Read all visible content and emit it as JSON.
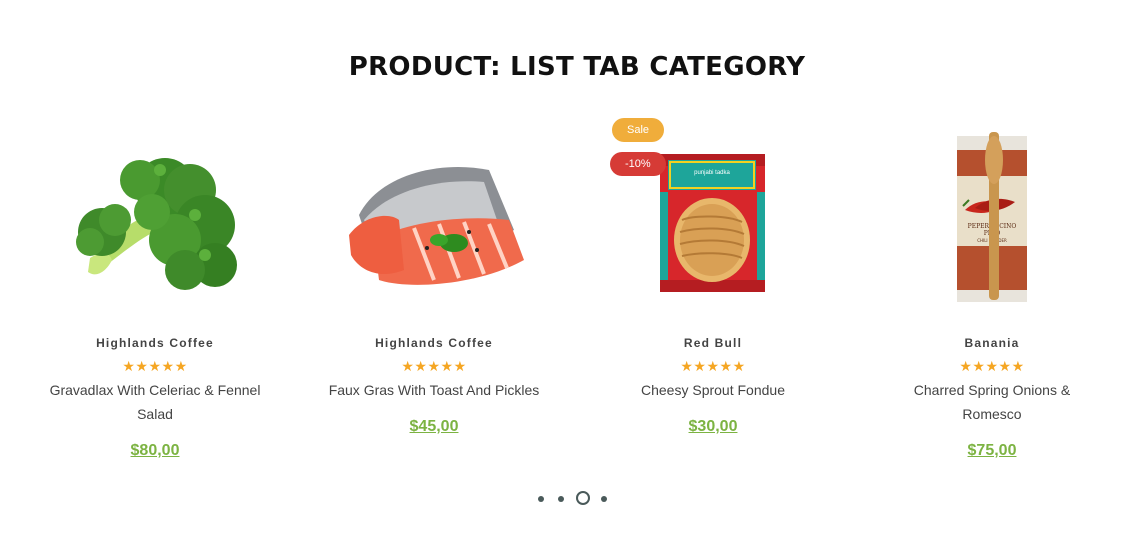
{
  "section": {
    "title": "PRODUCT: LIST TAB CATEGORY"
  },
  "products": [
    {
      "brand": "Highlands Coffee",
      "rating": "★★★★★",
      "title": "Gravadlax With Celeriac & Fennel Salad",
      "price": "$80,00",
      "image": "broccoli"
    },
    {
      "brand": "Highlands Coffee",
      "rating": "★★★★★",
      "title": "Faux Gras With Toast And Pickles",
      "price": "$45,00",
      "image": "salmon-fillet"
    },
    {
      "brand": "Red Bull",
      "rating": "★★★★★",
      "title": "Cheesy Sprout Fondue",
      "price": "$30,00",
      "image": "noodle-pack",
      "badges": {
        "sale": "Sale",
        "discount": "-10%"
      }
    },
    {
      "brand": "Banania",
      "rating": "★★★★★",
      "title": "Charred Spring Onions & Romesco",
      "price": "$75,00",
      "image": "chili-powder-bag",
      "label_text": {
        "line1": "PEPERONCINO",
        "line2": "PINO",
        "line3": "CHILI POWDER"
      }
    }
  ],
  "noodle_label": "punjabi tadka",
  "colors": {
    "price": "#7cb342",
    "star": "#f5a623",
    "sale": "#f0ad3b",
    "discount": "#d63b36"
  },
  "carousel": {
    "pages": 4,
    "active_index": 2
  }
}
